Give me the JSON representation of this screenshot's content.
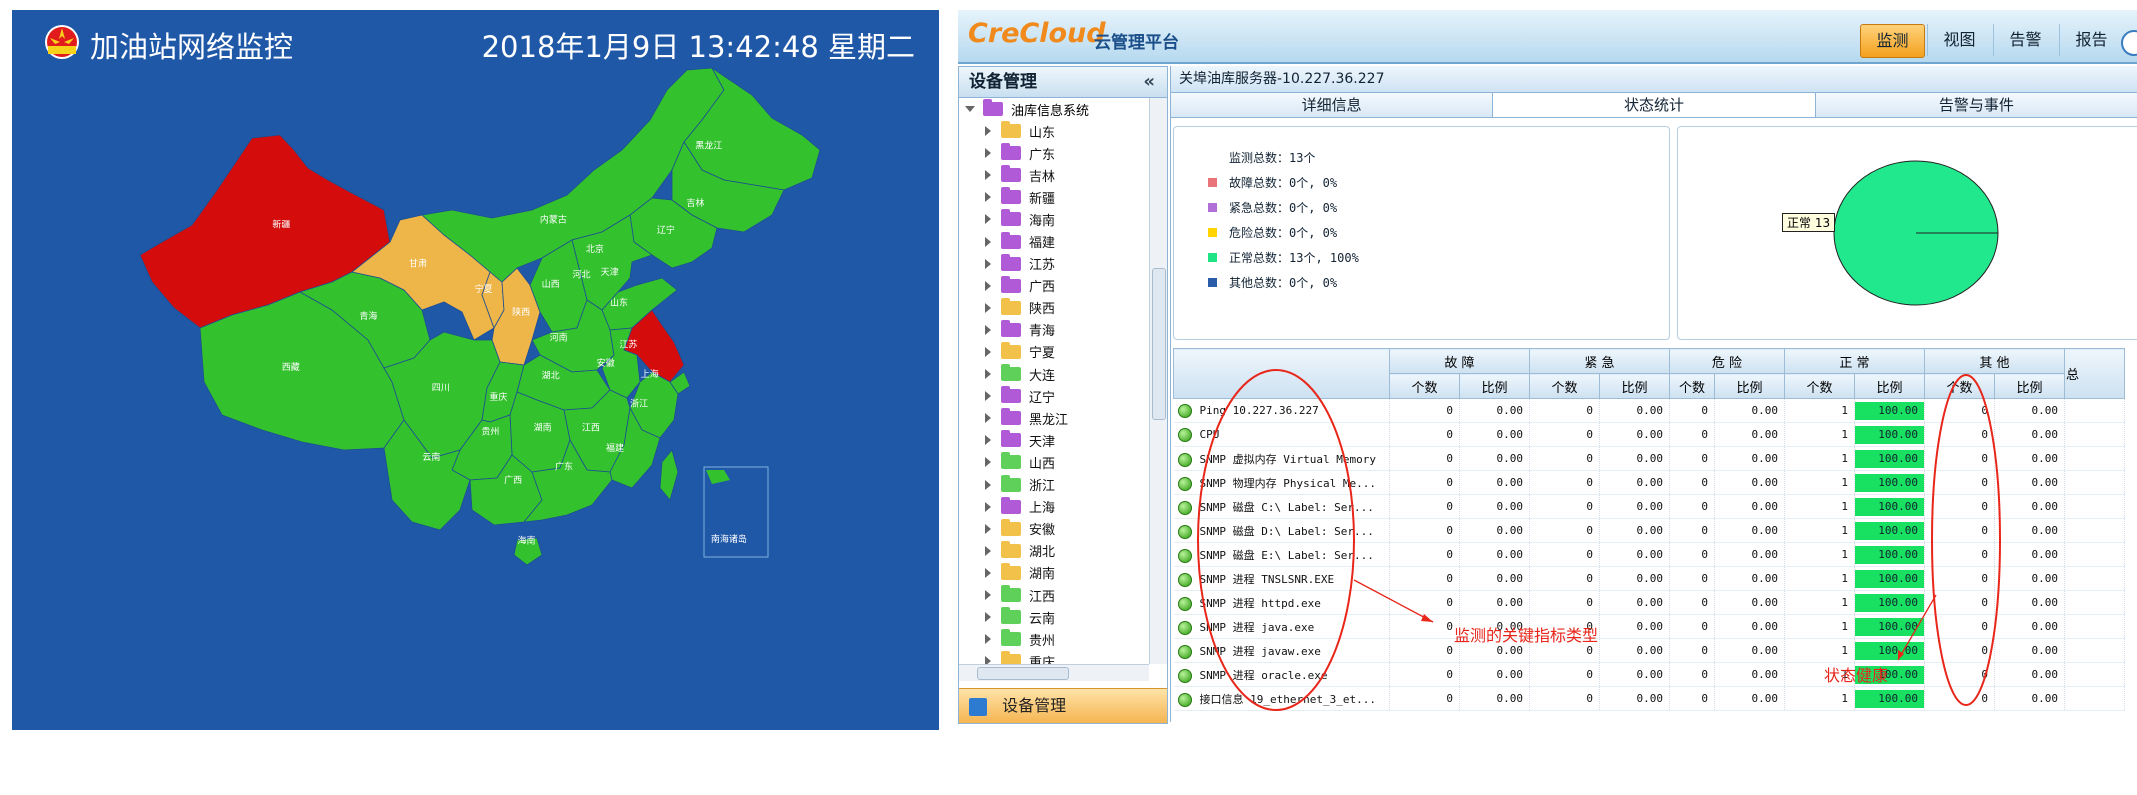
{
  "left": {
    "title": "加油站网络监控",
    "datetime": "2018年1月9日 13:42:48 星期二",
    "colors": {
      "bg": "#2058a8",
      "normal": "#33c12e",
      "warning": "#eeb548",
      "fault": "#d40c0c"
    },
    "provinces": [
      {
        "name": "新疆",
        "status": "fault"
      },
      {
        "name": "甘肃",
        "status": "warning"
      },
      {
        "name": "宁夏",
        "status": "warning"
      },
      {
        "name": "陕西",
        "status": "warning"
      },
      {
        "name": "江苏",
        "status": "fault"
      },
      {
        "name": "西藏",
        "status": "normal"
      },
      {
        "name": "青海",
        "status": "normal"
      },
      {
        "name": "四川",
        "status": "normal"
      },
      {
        "name": "内蒙古",
        "status": "normal"
      },
      {
        "name": "黑龙江",
        "status": "normal"
      },
      {
        "name": "吉林",
        "status": "normal"
      },
      {
        "name": "辽宁",
        "status": "normal"
      },
      {
        "name": "北京",
        "status": "normal"
      },
      {
        "name": "天津",
        "status": "normal"
      },
      {
        "name": "河北",
        "status": "normal"
      },
      {
        "name": "山西",
        "status": "normal"
      },
      {
        "name": "山东",
        "status": "normal"
      },
      {
        "name": "河南",
        "status": "normal"
      },
      {
        "name": "安徽",
        "status": "normal"
      },
      {
        "name": "上海",
        "status": "normal"
      },
      {
        "name": "湖北",
        "status": "normal"
      },
      {
        "name": "浙江",
        "status": "normal"
      },
      {
        "name": "重庆",
        "status": "normal"
      },
      {
        "name": "湖南",
        "status": "normal"
      },
      {
        "name": "江西",
        "status": "normal"
      },
      {
        "name": "福建",
        "status": "normal"
      },
      {
        "name": "贵州",
        "status": "normal"
      },
      {
        "name": "云南",
        "status": "normal"
      },
      {
        "name": "广西",
        "status": "normal"
      },
      {
        "name": "广东",
        "status": "normal"
      },
      {
        "name": "海南",
        "status": "normal"
      },
      {
        "name": "南海诸岛",
        "status": "normal"
      }
    ]
  },
  "right": {
    "brand": "CreCloud",
    "brand_sub": "云管理平台",
    "nav": [
      "监测",
      "视图",
      "告警",
      "报告"
    ],
    "nav_active": 0,
    "tree": {
      "header": "设备管理",
      "collapse_icon": "double-chevron-left-icon",
      "root": "油库信息系统",
      "items": [
        {
          "label": "山东",
          "color": "#f2c14a"
        },
        {
          "label": "广东",
          "color": "#b05ad8"
        },
        {
          "label": "吉林",
          "color": "#b05ad8"
        },
        {
          "label": "新疆",
          "color": "#b05ad8"
        },
        {
          "label": "海南",
          "color": "#b05ad8"
        },
        {
          "label": "福建",
          "color": "#b05ad8"
        },
        {
          "label": "江苏",
          "color": "#b05ad8"
        },
        {
          "label": "广西",
          "color": "#b05ad8"
        },
        {
          "label": "陕西",
          "color": "#f2c14a"
        },
        {
          "label": "青海",
          "color": "#b05ad8"
        },
        {
          "label": "宁夏",
          "color": "#f2c14a"
        },
        {
          "label": "大连",
          "color": "#5fd05a"
        },
        {
          "label": "辽宁",
          "color": "#b05ad8"
        },
        {
          "label": "黑龙江",
          "color": "#b05ad8"
        },
        {
          "label": "天津",
          "color": "#b05ad8"
        },
        {
          "label": "山西",
          "color": "#5fd05a"
        },
        {
          "label": "浙江",
          "color": "#5fd05a"
        },
        {
          "label": "上海",
          "color": "#b05ad8"
        },
        {
          "label": "安徽",
          "color": "#f2c14a"
        },
        {
          "label": "湖北",
          "color": "#f2c14a"
        },
        {
          "label": "湖南",
          "color": "#f2c14a"
        },
        {
          "label": "江西",
          "color": "#5fd05a"
        },
        {
          "label": "云南",
          "color": "#5fd05a"
        },
        {
          "label": "贵州",
          "color": "#5fd05a"
        },
        {
          "label": "重庆",
          "color": "#f2c14a"
        }
      ],
      "footer": "设备管理"
    },
    "main": {
      "title": "关埠油库服务器-10.227.36.227",
      "tabs": [
        "详细信息",
        "状态统计",
        "告警与事件"
      ],
      "tab_active": 1,
      "summary": [
        {
          "text": "监测总数：13个",
          "color": ""
        },
        {
          "text": "故障总数：0个, 0%",
          "color": "#e8747a"
        },
        {
          "text": "紧急总数：0个, 0%",
          "color": "#b070d8"
        },
        {
          "text": "危险总数：0个, 0%",
          "color": "#ffd400"
        },
        {
          "text": "正常总数：13个, 100%",
          "color": "#1ee486"
        },
        {
          "text": "其他总数：0个, 0%",
          "color": "#2a5caa"
        }
      ],
      "pie": {
        "label": "正常 13",
        "color": "#21e88c",
        "normal": 13,
        "total": 13
      },
      "table": {
        "groups": [
          "故 障",
          "紧 急",
          "危 险",
          "正 常",
          "其 他",
          "总"
        ],
        "sub": [
          "个数",
          "比例"
        ],
        "rows": [
          {
            "name": "Ping 10.227.36.227",
            "cols": [
              "0",
              "0.00",
              "0",
              "0.00",
              "0",
              "0.00",
              "1",
              "100.00",
              "0",
              "0.00"
            ]
          },
          {
            "name": "CPU",
            "cols": [
              "0",
              "0.00",
              "0",
              "0.00",
              "0",
              "0.00",
              "1",
              "100.00",
              "0",
              "0.00"
            ]
          },
          {
            "name": "SNMP 虚拟内存 Virtual Memory",
            "cols": [
              "0",
              "0.00",
              "0",
              "0.00",
              "0",
              "0.00",
              "1",
              "100.00",
              "0",
              "0.00"
            ]
          },
          {
            "name": "SNMP 物理内存 Physical Me...",
            "cols": [
              "0",
              "0.00",
              "0",
              "0.00",
              "0",
              "0.00",
              "1",
              "100.00",
              "0",
              "0.00"
            ]
          },
          {
            "name": "SNMP 磁盘 C:\\ Label:  Ser...",
            "cols": [
              "0",
              "0.00",
              "0",
              "0.00",
              "0",
              "0.00",
              "1",
              "100.00",
              "0",
              "0.00"
            ]
          },
          {
            "name": "SNMP 磁盘 D:\\ Label:  Ser...",
            "cols": [
              "0",
              "0.00",
              "0",
              "0.00",
              "0",
              "0.00",
              "1",
              "100.00",
              "0",
              "0.00"
            ]
          },
          {
            "name": "SNMP 磁盘 E:\\ Label:  Ser...",
            "cols": [
              "0",
              "0.00",
              "0",
              "0.00",
              "0",
              "0.00",
              "1",
              "100.00",
              "0",
              "0.00"
            ]
          },
          {
            "name": "SNMP 进程 TNSLSNR.EXE",
            "cols": [
              "0",
              "0.00",
              "0",
              "0.00",
              "0",
              "0.00",
              "1",
              "100.00",
              "0",
              "0.00"
            ]
          },
          {
            "name": "SNMP 进程 httpd.exe",
            "cols": [
              "0",
              "0.00",
              "0",
              "0.00",
              "0",
              "0.00",
              "1",
              "100.00",
              "0",
              "0.00"
            ]
          },
          {
            "name": "SNMP 进程 java.exe",
            "cols": [
              "0",
              "0.00",
              "0",
              "0.00",
              "0",
              "0.00",
              "1",
              "100.00",
              "0",
              "0.00"
            ]
          },
          {
            "name": "SNMP 进程 javaw.exe",
            "cols": [
              "0",
              "0.00",
              "0",
              "0.00",
              "0",
              "0.00",
              "1",
              "100.00",
              "0",
              "0.00"
            ]
          },
          {
            "name": "SNMP 进程 oracle.exe",
            "cols": [
              "0",
              "0.00",
              "0",
              "0.00",
              "0",
              "0.00",
              "1",
              "100.00",
              "0",
              "0.00"
            ]
          },
          {
            "name": "接口信息 19_ethernet_3_et...",
            "cols": [
              "0",
              "0.00",
              "0",
              "0.00",
              "0",
              "0.00",
              "1",
              "100.00",
              "0",
              "0.00"
            ]
          }
        ]
      }
    },
    "annotations": {
      "key_metrics": "监测的关键指标类型",
      "healthy": "状态健康",
      "color": "#e8261a"
    }
  }
}
